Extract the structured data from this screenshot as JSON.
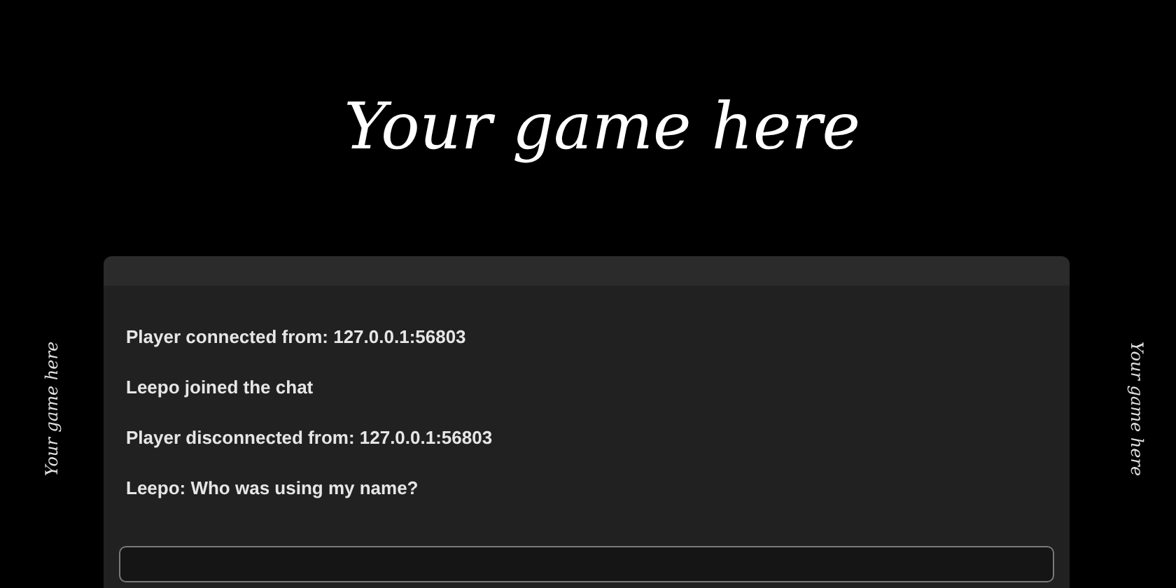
{
  "title": "Your game here",
  "side_left": "Your game here",
  "side_right": "Your game here",
  "chat": {
    "messages": [
      "Player connected from: 127.0.0.1:56803",
      "Leepo joined the chat",
      "Player disconnected from: 127.0.0.1:56803",
      "Leepo: Who was using my name?"
    ]
  }
}
